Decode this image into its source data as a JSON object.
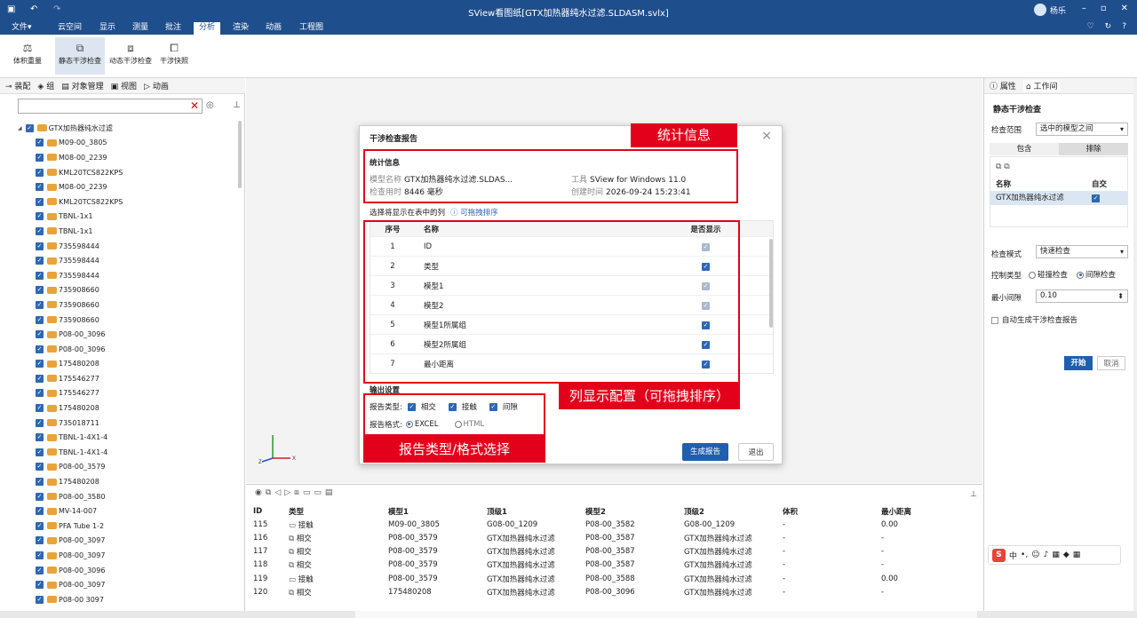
{
  "window": {
    "title": "SView看图纸[GTX加热器纯水过滤.SLDASM.svlx]",
    "user_name": "杨乐"
  },
  "menubar": {
    "items": [
      "文件",
      "云空间",
      "显示",
      "测量",
      "批注",
      "分析",
      "渲染",
      "动画",
      "工程图"
    ],
    "active": "分析"
  },
  "ribbon": {
    "buttons": [
      {
        "label": "体积重量",
        "icon": "volume-weight-icon"
      },
      {
        "label": "静态干涉检查",
        "icon": "static-interference-icon",
        "active": true
      },
      {
        "label": "动态干涉检查",
        "icon": "dynamic-interference-icon"
      },
      {
        "label": "干涉快照",
        "icon": "interference-snapshot-icon"
      }
    ]
  },
  "left_panel": {
    "tabs": [
      "装配",
      "组",
      "对象管理",
      "视图",
      "动画"
    ],
    "tree": [
      "GTX加热器纯水过滤",
      "M09-00_3805",
      "M08-00_2239",
      "KML20TCS822KPS",
      "M08-00_2239",
      "KML20TCS822KPS",
      "TBNL-1x1",
      "TBNL-1x1",
      "735598444",
      "735598444",
      "735598444",
      "735908660",
      "735908660",
      "735908660",
      "P08-00_3096",
      "P08-00_3096",
      "175480208",
      "175546277",
      "175546277",
      "175480208",
      "735018711",
      "TBNL-1-4X1-4",
      "TBNL-1-4X1-4",
      "P08-00_3579",
      "175480208",
      "P08-00_3580",
      "MV-14-007",
      "PFA Tube 1-2",
      "P08-00_3097",
      "P08-00_3097",
      "P08-00_3096",
      "P08-00_3097",
      "P08-00 3097"
    ]
  },
  "dialog": {
    "title": "干涉检查报告",
    "stats_header": "统计信息",
    "stats": {
      "model_name_label": "模型名称",
      "model_name": "GTX加热器纯水过滤.SLDAS...",
      "tool_label": "工具",
      "tool": "SView for Windows 11.0",
      "check_time_label": "检查用时",
      "check_time": "8446 毫秒",
      "created_label": "创建时间",
      "created": "2026-09-24 15:23:41"
    },
    "columns_header": "选择将显示在表中的列",
    "drag_hint": "可拖拽排序",
    "table_headers": [
      "序号",
      "名称",
      "是否显示"
    ],
    "columns": [
      {
        "num": "1",
        "name": "ID",
        "shown": true,
        "locked": true
      },
      {
        "num": "2",
        "name": "类型",
        "shown": true,
        "locked": false
      },
      {
        "num": "3",
        "name": "模型1",
        "shown": true,
        "locked": true
      },
      {
        "num": "4",
        "name": "模型2",
        "shown": true,
        "locked": true
      },
      {
        "num": "5",
        "name": "模型1所属组",
        "shown": true,
        "locked": false
      },
      {
        "num": "6",
        "name": "模型2所属组",
        "shown": true,
        "locked": false
      },
      {
        "num": "7",
        "name": "最小距离",
        "shown": true,
        "locked": false
      }
    ],
    "output_header": "输出设置",
    "report_type_label": "报告类型:",
    "report_types": [
      {
        "label": "相交",
        "checked": true
      },
      {
        "label": "接触",
        "checked": true
      },
      {
        "label": "间隙",
        "checked": true
      }
    ],
    "report_format_label": "报告格式:",
    "report_formats": [
      {
        "label": "EXCEL",
        "selected": true
      },
      {
        "label": "HTML",
        "selected": false
      }
    ],
    "generate_button": "生成报告",
    "exit_button": "退出"
  },
  "annotations": {
    "stats": "统计信息",
    "columns": "列显示配置（可拖拽排序）",
    "report": "报告类型/格式选择"
  },
  "right_panel": {
    "tabs": [
      "属性",
      "工作间"
    ],
    "title": "静态干涉检查",
    "scope_label": "检查范围",
    "scope_value": "选中的模型之间",
    "include_tab": "包含",
    "exclude_tab": "排除",
    "list_header_name": "名称",
    "list_header_self": "自交",
    "list_item": "GTX加热器纯水过滤",
    "mode_label": "检查模式",
    "mode_value": "快速检查",
    "control_label": "控制类型",
    "collision_option": "碰撞检查",
    "clearance_option": "间隙检查",
    "min_gap_label": "最小间隙",
    "min_gap_value": "0.10",
    "auto_report_label": "自动生成干涉检查报告",
    "start_button": "开始",
    "cancel_button": "取消"
  },
  "results": {
    "headers": [
      "ID",
      "类型",
      "模型1",
      "顶级1",
      "模型2",
      "顶级2",
      "体积",
      "最小距离"
    ],
    "rows": [
      [
        "115",
        "接触",
        "M09-00_3805",
        "G08-00_1209",
        "P08-00_3582",
        "G08-00_1209",
        "-",
        "0.00"
      ],
      [
        "116",
        "相交",
        "P08-00_3579",
        "GTX加热器纯水过滤",
        "P08-00_3587",
        "GTX加热器纯水过滤",
        "-",
        "-"
      ],
      [
        "117",
        "相交",
        "P08-00_3579",
        "GTX加热器纯水过滤",
        "P08-00_3587",
        "GTX加热器纯水过滤",
        "-",
        "-"
      ],
      [
        "118",
        "相交",
        "P08-00_3579",
        "GTX加热器纯水过滤",
        "P08-00_3587",
        "GTX加热器纯水过滤",
        "-",
        "-"
      ],
      [
        "119",
        "接触",
        "P08-00_3579",
        "GTX加热器纯水过滤",
        "P08-00_3588",
        "GTX加热器纯水过滤",
        "-",
        "0.00"
      ],
      [
        "120",
        "相交",
        "175480208",
        "GTX加热器纯水过滤",
        "P08-00_3096",
        "GTX加热器纯水过滤",
        "-",
        "-"
      ]
    ]
  },
  "ime": {
    "label": "中"
  }
}
